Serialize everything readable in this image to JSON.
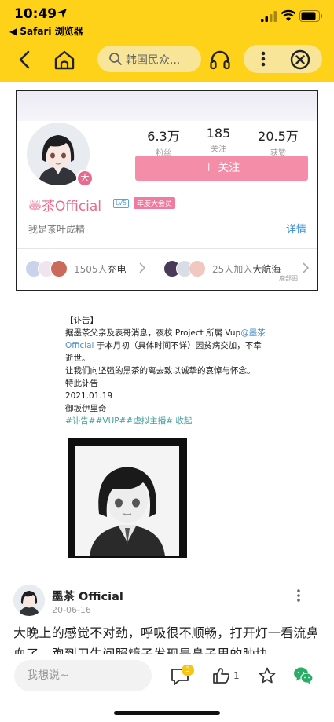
{
  "status_bar": {
    "time": "10:49",
    "back_app": "◀ Safari 浏览器"
  },
  "toolbar": {
    "search_text": "韩国民众...",
    "icons": [
      "back-arrow-icon",
      "home-icon",
      "search-icon",
      "headphones-icon",
      "more-vertical-icon",
      "close-circle-icon"
    ],
    "accent_color": "#ffd21a"
  },
  "profile_card": {
    "stats": [
      {
        "value": "6.3万",
        "label": "粉丝"
      },
      {
        "value": "185",
        "label": "关注"
      },
      {
        "value": "20.5万",
        "label": "获赞"
      }
    ],
    "follow_label": "＋ 关注",
    "avatar_badge": "大",
    "username": "墨茶Official",
    "level_badge": "LV5",
    "vip_badge": "年度大会员",
    "bio": "我是茶叶成精",
    "detail_link": "详情",
    "charge": {
      "count": "1505人",
      "label": "充电"
    },
    "crew": {
      "count": "25人加入",
      "label": "大航海"
    },
    "watermark": "鹿部图"
  },
  "obituary": {
    "heading": "【讣告】",
    "line1_pre": "据墨茶父亲及表哥消息，夜校 Project 所属 Vup",
    "line1_link": "@墨茶 Official",
    "line1_post": " 于本月初（具体时间不详）因贫病交加，不幸逝世。",
    "line2": "让我们向坚强的黑茶的离去致以诚挚的哀悼与怀念。",
    "line3": "特此讣告",
    "date": "2021.01.19",
    "signer": "御坂伊里奇",
    "tags": "#讣告##VUP##虚拟主播# 收起"
  },
  "post": {
    "author": "墨茶 Official",
    "date": "20-06-16",
    "body": "大晚上的感觉不对劲，呼吸很不顺畅，打开灯一看流鼻血了。跑到卫生间照镜子发现是鼻子里的肿块"
  },
  "bottom_bar": {
    "comment_placeholder": "我想说~",
    "comment_badge": "3",
    "like_count": "1",
    "badge_color": "#f5c518",
    "wechat_color": "#2aae67"
  }
}
